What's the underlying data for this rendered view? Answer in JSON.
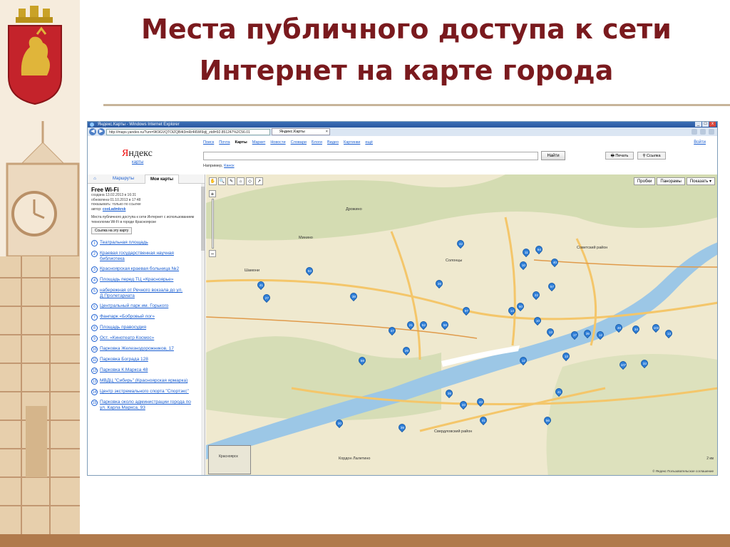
{
  "slide": {
    "title_line1": "Места публичного доступа к сети",
    "title_line2": "Интернет на карте города",
    "title_color": "#7a1a1e"
  },
  "browser": {
    "window_title": "Яндекс.Карты - Windows Internet Explorer",
    "url": "http://maps.yandex.ru/?um=9K9GVQTOlZQB4t3mRr4l6WI9qlj_ztdl=92.851247%2C56.01",
    "tab_title": "Яндекс.Карты",
    "win_controls": [
      "_",
      "□",
      "x"
    ],
    "nav_back": "◀",
    "nav_forward": "▶"
  },
  "yandex": {
    "logo_red": "Я",
    "logo_rest": "ндекс",
    "logo_sub": "карты",
    "nav": [
      "Поиск",
      "Почта",
      "Карты",
      "Маркет",
      "Новости",
      "Словари",
      "Блоги",
      "Видео",
      "Картинки",
      "ещё"
    ],
    "login": "Войти",
    "find_button": "Найти",
    "example_prefix": "Например,",
    "example_link": "Канск",
    "print_button": "Печать",
    "link_button": "Ссылка"
  },
  "panel": {
    "tab_home": "⌂",
    "tab_routes": "Маршруты",
    "tab_my_maps": "Мои карты",
    "map_title": "Free Wi-Fi",
    "created": "создана 13.02.2013 в 16:31",
    "updated": "обновлена 01.10.2013 в 17:48",
    "visibility": "показывать: только по ссылке",
    "author_prefix": "автор:",
    "author": "cooLadmkrsk",
    "description": "Места публичного доступа к сети Интернет с использованием технологии Wi-Fi в городе Красноярске",
    "map_link_button": "Ссылка на эту карту",
    "places": [
      {
        "num": "1",
        "label": "Театральная площадь"
      },
      {
        "num": "2",
        "label": "Краевая государственная научная библиотека"
      },
      {
        "num": "3",
        "label": "Красноярская краевая больница №2"
      },
      {
        "num": "4",
        "label": "Площадь перед ТЦ «Красноярье»"
      },
      {
        "num": "5",
        "label": "набережная от Речного вокзала до ул. Д.Пролетариата"
      },
      {
        "num": "6",
        "label": "Центральный парк им. Горького"
      },
      {
        "num": "7",
        "label": "Фанпарк «Бобровый лог»"
      },
      {
        "num": "8",
        "label": "Площадь правосудия"
      },
      {
        "num": "9",
        "label": "Ост. «Кинотеатр Космос»"
      },
      {
        "num": "10",
        "label": "Парковка Железнодорожников, 17"
      },
      {
        "num": "11",
        "label": "Парковка Бограда 128"
      },
      {
        "num": "12",
        "label": "Парковка К.Маркса 48"
      },
      {
        "num": "13",
        "label": "МВДЦ \"Сибирь\" (Красноярская ярмарка)"
      },
      {
        "num": "14",
        "label": "Центр экстремального спорта \"Спортэкс\""
      },
      {
        "num": "15",
        "label": "Парковка около администрации города по ул. Карла Маркса, 93"
      }
    ]
  },
  "map": {
    "tools": [
      "✋",
      "🔍",
      "✎",
      "⌂",
      "◇",
      "↗"
    ],
    "zoom_in": "+",
    "zoom_out": "−",
    "controls": [
      "Пробки",
      "Панорамы",
      "Показать ▾"
    ],
    "minimap_label": "Красноярск",
    "scale": "2 км",
    "copyright": "© Яндекс  Пользовательское соглашение",
    "labels": [
      {
        "text": "Дрожино"
      },
      {
        "text": "Минино"
      },
      {
        "text": "Солонцы"
      },
      {
        "text": "Шамони"
      },
      {
        "text": "Кордон Лалетино"
      },
      {
        "text": "Свердловский район"
      },
      {
        "text": "Советский район"
      }
    ],
    "pins": [
      "42",
      "11",
      "64",
      "10",
      "40",
      "38",
      "41",
      "27",
      "28",
      "53",
      "97",
      "60",
      "22",
      "57",
      "14",
      "10",
      "13",
      "47",
      "21",
      "52",
      "58",
      "59",
      "29",
      "28",
      "33",
      "43",
      "41",
      "56",
      "12",
      "13",
      "17",
      "35",
      "12",
      "48",
      "34",
      "102",
      "13",
      "107",
      "33",
      "41",
      "39",
      "20"
    ],
    "colors": {
      "land": "#efe9cf",
      "water": "#9cc7e6",
      "forest": "#cfd9ad",
      "road": "#f4c66a",
      "pin": "#2f7fd8"
    }
  }
}
